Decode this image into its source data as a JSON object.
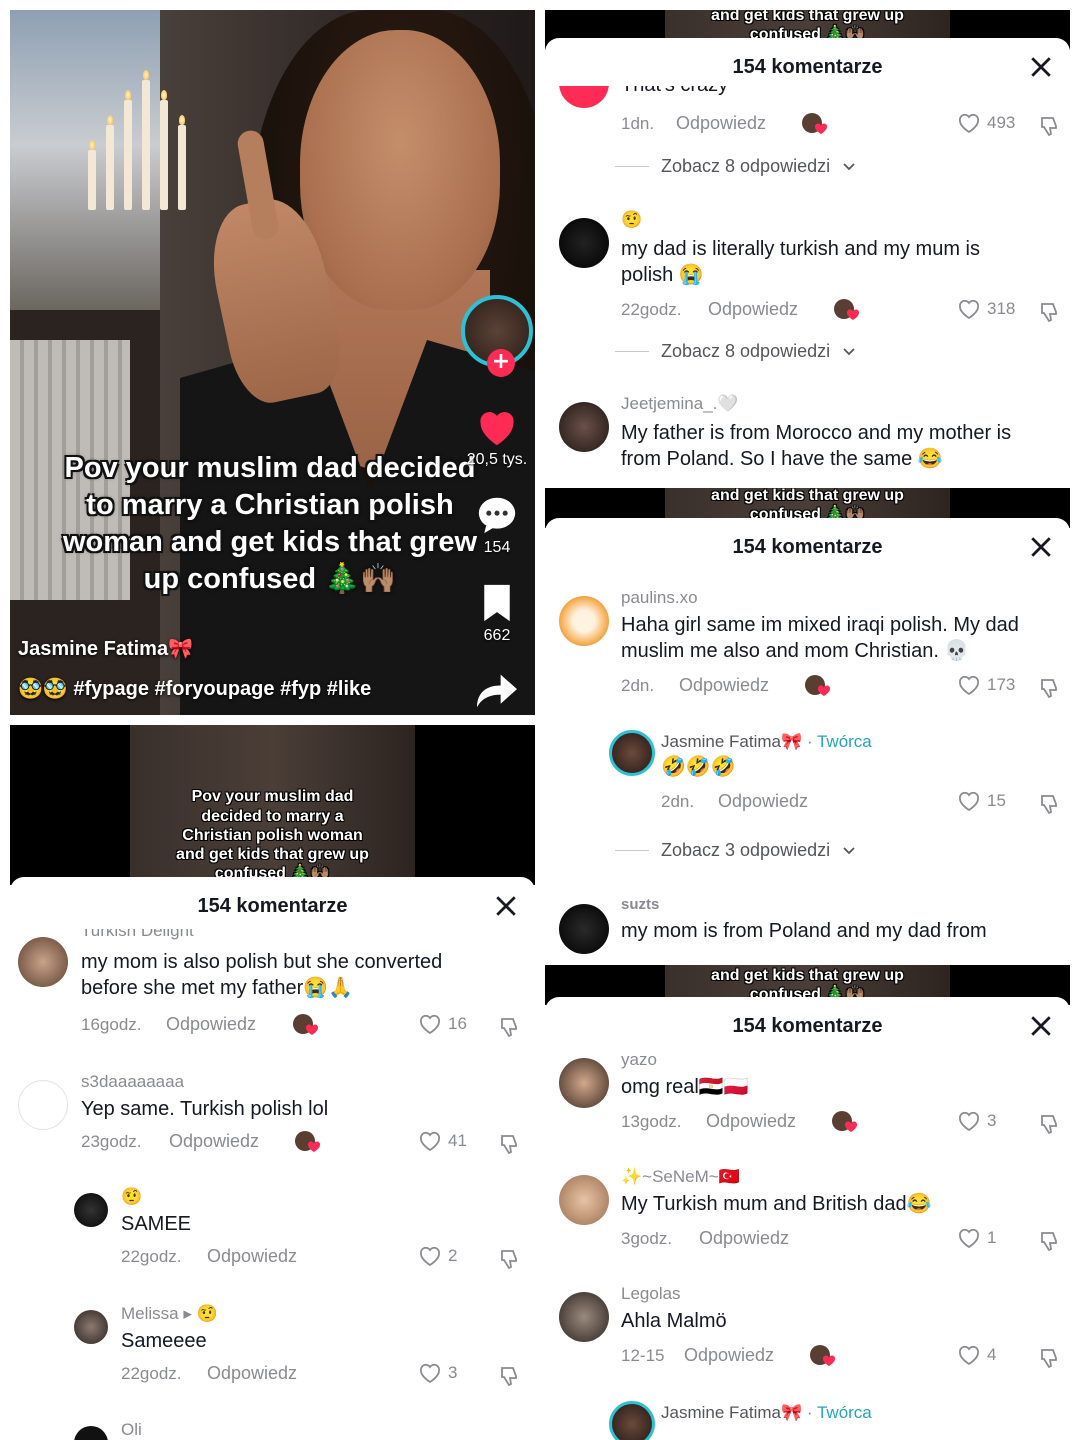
{
  "video": {
    "caption": "Pov your muslim dad decided to marry a Christian polish woman and get kids that grew up confused 🎄🙌🏽",
    "author": "Jasmine Fatima🎀",
    "tags": "🥸🥸 #fypage #foryoupage #fyp #like",
    "likes": "20,5 tys.",
    "comments": "154",
    "saves": "662"
  },
  "strip": {
    "small_caption": [
      "Pov your muslim dad",
      "decided to marry a",
      "Christian polish woman",
      "and get kids that grew up",
      "confused 🎄🙌🏽"
    ],
    "line_a": "and get kids that grew up",
    "line_b": "confused 🎄🙌🏽"
  },
  "sheet": {
    "title": "154 komentarze",
    "reply_label": "Odpowiedz",
    "creator_label": "· Twórca"
  },
  "panel2": {
    "comments": [
      {
        "user": "Turkish Delight",
        "text": "my mom is also polish but she converted before she met my father😭🙏",
        "time": "16godz.",
        "likes": "16"
      },
      {
        "user": "s3daaaaaaaa",
        "text": "Yep same. Turkish polish lol",
        "time": "23godz.",
        "likes": "41"
      },
      {
        "user": "🤨",
        "text": "SAMEE",
        "time": "22godz.",
        "likes": "2"
      },
      {
        "user": "Melissa ▸ 🤨",
        "text": "Sameeee",
        "time": "22godz.",
        "likes": "3"
      },
      {
        "user": "Oli"
      }
    ]
  },
  "panel3": {
    "top_text": "That's crazy",
    "top_time": "1dn.",
    "top_likes": "493",
    "more1": "Zobacz 8 odpowiedzi",
    "comments": [
      {
        "user": "🤨",
        "text": "my dad is literally turkish and my mum is polish 😭",
        "time": "22godz.",
        "likes": "318"
      },
      {
        "user": "Jeetjemina_.🤍",
        "text": "My father is from Morocco and my mother is from Poland. So I have the same 😂"
      }
    ],
    "more2": "Zobacz 8 odpowiedzi"
  },
  "panel4": {
    "comments": [
      {
        "user": "paulins.xo",
        "text": "Haha girl same im mixed iraqi polish. My dad muslim me also and mom Christian. 💀",
        "time": "2dn.",
        "likes": "173"
      },
      {
        "user": "Jasmine Fatima🎀",
        "text": "🤣🤣🤣",
        "time": "2dn.",
        "likes": "15"
      },
      {
        "user": "suzts",
        "text": "my mom is from Poland and my dad from"
      }
    ],
    "more": "Zobacz 3 odpowiedzi"
  },
  "panel5": {
    "comments": [
      {
        "user": "yazo",
        "text": "omg real🇪🇬🇵🇱",
        "time": "13godz.",
        "likes": "3"
      },
      {
        "user": "✨~SeNeM~🇹🇷",
        "text": "My Turkish mum and British dad😂",
        "time": "3godz.",
        "likes": "1"
      },
      {
        "user": "Legolas",
        "text": "Ahla Malmö",
        "time": "12-15",
        "likes": "4"
      },
      {
        "user": "Jasmine Fatima🎀"
      }
    ]
  },
  "colors": {
    "accent": "#fe2c55",
    "creator": "#25a2c2",
    "ring": "#2dc1d6"
  },
  "icons": [
    "heart-icon",
    "comment-bubble-icon",
    "bookmark-icon",
    "share-arrow-icon",
    "close-icon",
    "dislike-icon",
    "chevron-down-icon",
    "plus-icon"
  ]
}
